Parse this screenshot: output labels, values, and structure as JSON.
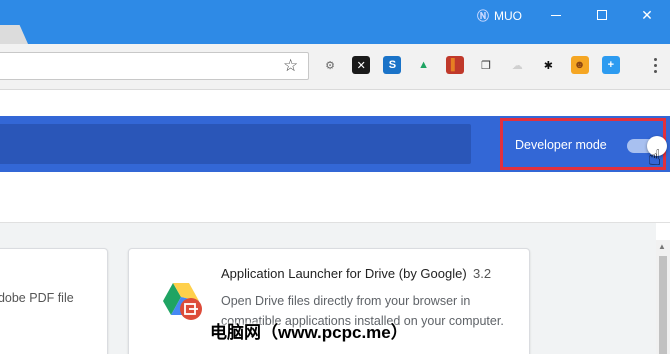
{
  "window": {
    "badge_label": "MUO",
    "minimize_symbol": "",
    "close_symbol": "✕"
  },
  "toolbar": {
    "bookmark_icon": "star-icon",
    "extensions": [
      {
        "name": "gear-extension-icon",
        "glyph": "⚙",
        "bg": "#f2f2f2",
        "fg": "#666"
      },
      {
        "name": "x-extension-icon",
        "glyph": "✕",
        "bg": "#1a1a1a",
        "fg": "#fff"
      },
      {
        "name": "s-extension-icon",
        "glyph": "S",
        "bg": "#1a73c8",
        "fg": "#fff"
      },
      {
        "name": "google-drive-extension-icon",
        "glyph": "▲",
        "bg": "#f2f2f2",
        "fg": "#1fa463"
      },
      {
        "name": "book-extension-icon",
        "glyph": "▌",
        "bg": "#c0392b",
        "fg": "#e67e22"
      },
      {
        "name": "copy-extension-icon",
        "glyph": "❐",
        "bg": "#f2f2f2",
        "fg": "#333"
      },
      {
        "name": "cloud-extension-icon",
        "glyph": "☁",
        "bg": "#f2f2f2",
        "fg": "#d0d0d0"
      },
      {
        "name": "paw-extension-icon",
        "glyph": "✱",
        "bg": "#f2f2f2",
        "fg": "#111"
      },
      {
        "name": "face-extension-icon",
        "glyph": "☻",
        "bg": "#f5a623",
        "fg": "#8b4513"
      },
      {
        "name": "plus-extension-icon",
        "glyph": "+",
        "bg": "#2d9bf0",
        "fg": "#fff"
      }
    ]
  },
  "header": {
    "developer_mode_label": "Developer mode",
    "developer_mode_on": true
  },
  "cards": {
    "left_desc": "adobe PDF file",
    "right": {
      "title": "Application Launcher for Drive (by Google)",
      "version": "3.2",
      "desc": "Open Drive files directly from your browser in compatible applications installed on your computer."
    }
  },
  "watermark": "电脑网（www.pcpc.me）",
  "colors": {
    "titlebar": "#2e8ae6",
    "header": "#3367d6",
    "highlight": "#e2303d"
  }
}
